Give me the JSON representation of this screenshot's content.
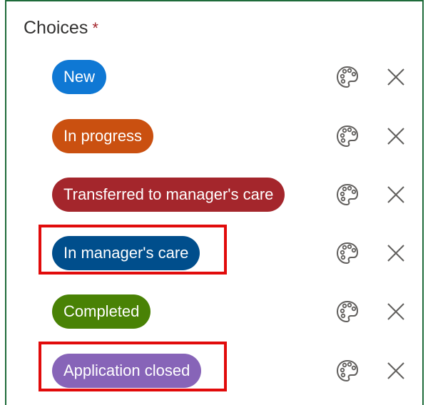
{
  "header": {
    "title": "Choices",
    "required_mark": "*"
  },
  "choices": [
    {
      "label": "New",
      "color": "#0f78d4"
    },
    {
      "label": "In progress",
      "color": "#ca5010"
    },
    {
      "label": "Transferred to manager's care",
      "color": "#a4262c"
    },
    {
      "label": "In manager's care",
      "color": "#004e8c"
    },
    {
      "label": "Completed",
      "color": "#498205"
    },
    {
      "label": "Application closed",
      "color": "#8764b8"
    }
  ],
  "icons": {
    "color": "palette-icon",
    "remove": "close-icon"
  },
  "accents": {
    "panel_border": "#1e6b3a",
    "highlight": "#e10b0b"
  }
}
